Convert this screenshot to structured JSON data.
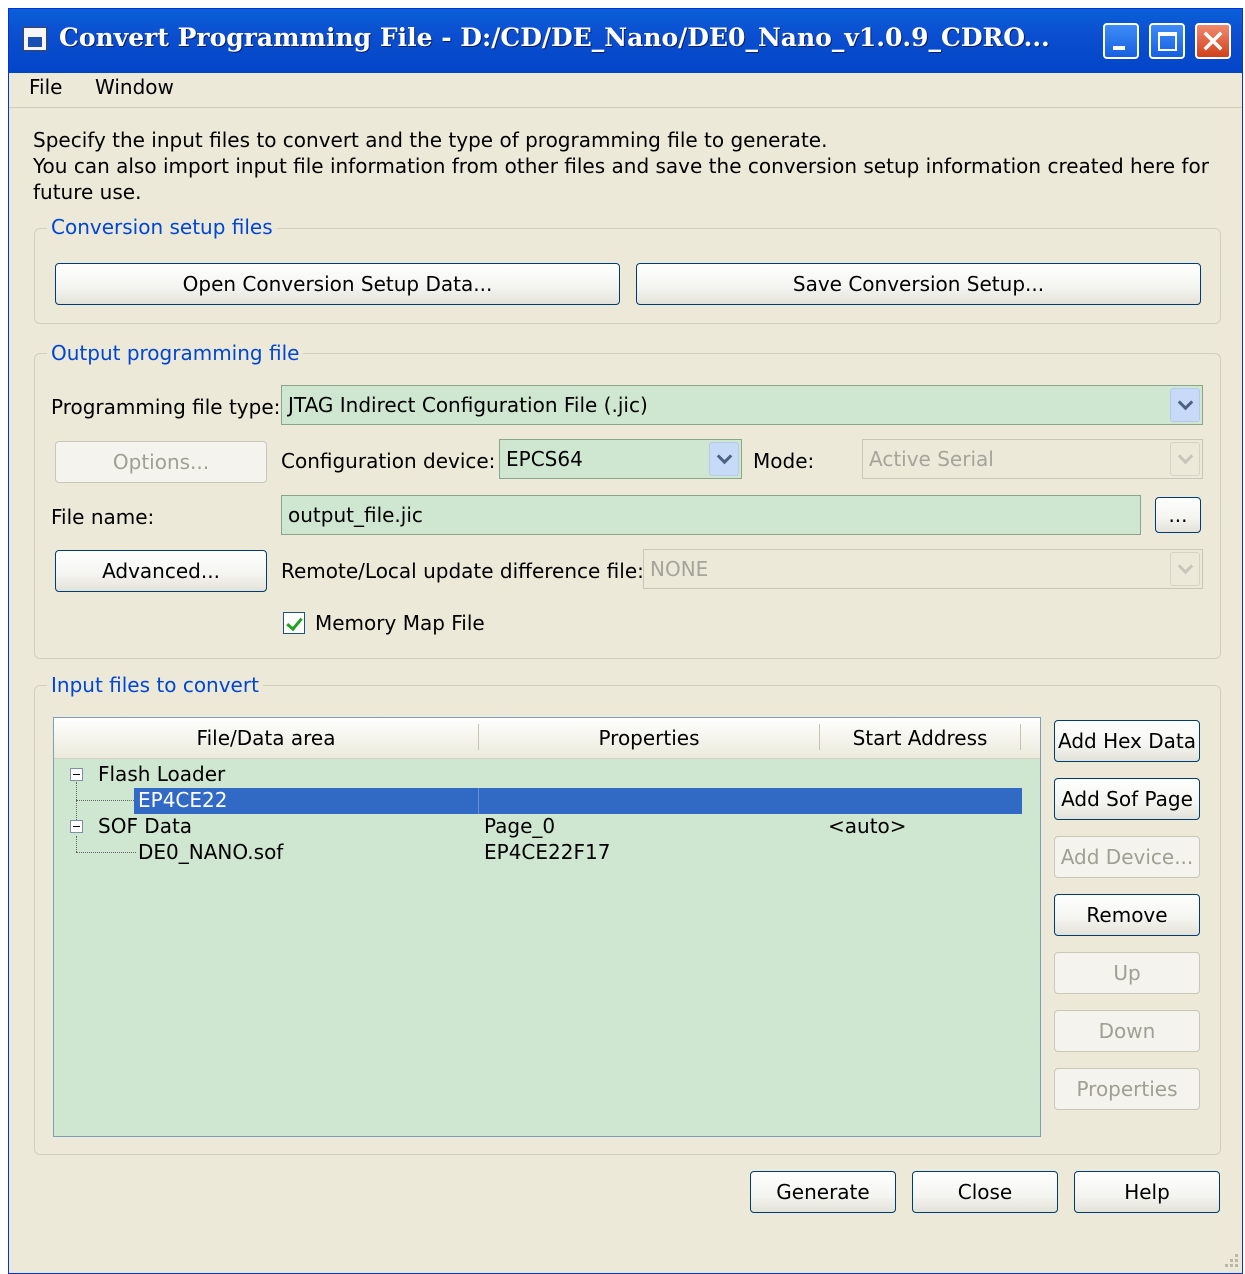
{
  "window": {
    "title": "Convert Programming File - D:/CD/DE_Nano/DE0_Nano_v1.0.9_CDRO...",
    "icon": "quartus-app-icon",
    "controls": [
      "minimize-icon",
      "maximize-icon",
      "close-icon"
    ]
  },
  "menu": {
    "items": [
      "File",
      "Window"
    ]
  },
  "description": [
    "Specify the input files to convert and the type of programming file to generate.",
    "You can also import input file information from other files and save the conversion setup information created here for",
    "future use."
  ],
  "setup": {
    "legend": "Conversion setup files",
    "open_label": "Open Conversion Setup Data...",
    "save_label": "Save Conversion Setup..."
  },
  "output": {
    "legend": "Output programming file",
    "type_label": "Programming file type:",
    "type_value": "JTAG Indirect Configuration File (.jic)",
    "options_label": "Options...",
    "config_label": "Configuration device:",
    "config_value": "EPCS64",
    "mode_label": "Mode:",
    "mode_value": "Active Serial",
    "filename_label": "File name:",
    "filename_value": "output_file.jic",
    "browse_label": "...",
    "advanced_label": "Advanced...",
    "remote_label": "Remote/Local update difference file:",
    "remote_value": "NONE",
    "memory_map_label": "Memory Map File",
    "memory_map_checked": true
  },
  "input": {
    "legend": "Input files to convert",
    "columns": [
      "File/Data area",
      "Properties",
      "Start Address"
    ],
    "rows": [
      {
        "name": "Flash Loader",
        "properties": "",
        "address": ""
      },
      {
        "name": "EP4CE22",
        "properties": "",
        "address": ""
      },
      {
        "name": "SOF Data",
        "properties": "Page_0",
        "address": "<auto>"
      },
      {
        "name": "DE0_NANO.sof",
        "properties": "EP4CE22F17",
        "address": ""
      }
    ],
    "selected_row": "EP4CE22",
    "buttons": {
      "add_hex": "Add Hex Data",
      "add_sof": "Add Sof Page",
      "add_device": "Add Device...",
      "remove": "Remove",
      "up": "Up",
      "down": "Down",
      "properties": "Properties"
    }
  },
  "footer": {
    "generate": "Generate",
    "close": "Close",
    "help": "Help"
  },
  "colors": {
    "title_bar": "#0A5FD8",
    "face": "#ECE9D8",
    "field": "#CFE7D0",
    "selection": "#316AC5",
    "legend_text": "#0046D5"
  }
}
